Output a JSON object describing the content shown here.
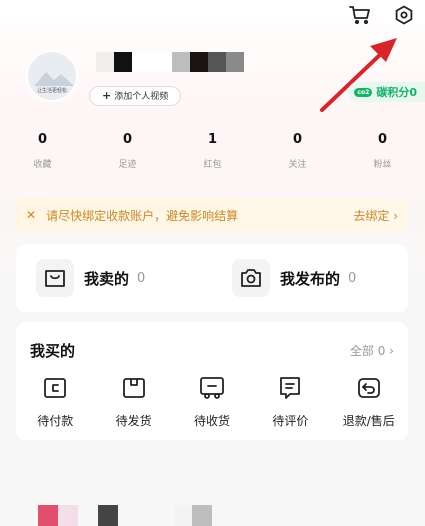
{
  "header": {
    "cart_icon": "cart-icon",
    "settings_icon": "settings-icon",
    "annotation_arrow_color": "#d6262b"
  },
  "profile": {
    "avatar_caption": "让生活更轻松",
    "add_video_label": "添加个人视频",
    "carbon_badge_icon": "co2",
    "carbon_label": "碳积分0"
  },
  "stats": [
    {
      "value": "0",
      "label": "收藏"
    },
    {
      "value": "0",
      "label": "足迹"
    },
    {
      "value": "1",
      "label": "红包"
    },
    {
      "value": "0",
      "label": "关注"
    },
    {
      "value": "0",
      "label": "粉丝"
    }
  ],
  "notice": {
    "close": "✕",
    "text": "请尽快绑定收款账户，避免影响结算",
    "action": "去绑定 ›"
  },
  "sell": {
    "sold_label": "我卖的",
    "sold_count": "0",
    "posted_label": "我发布的",
    "posted_count": "0"
  },
  "buy": {
    "title": "我买的",
    "all_label": "全部 0 ›",
    "items": [
      {
        "label": "待付款",
        "icon": "wallet-icon"
      },
      {
        "label": "待发货",
        "icon": "package-icon"
      },
      {
        "label": "待收货",
        "icon": "truck-icon"
      },
      {
        "label": "待评价",
        "icon": "comment-icon"
      },
      {
        "label": "退款/售后",
        "icon": "return-icon"
      }
    ]
  },
  "colors": {
    "accent_green": "#16b26b",
    "notice_text": "#c98a2a",
    "muted": "#999999"
  }
}
